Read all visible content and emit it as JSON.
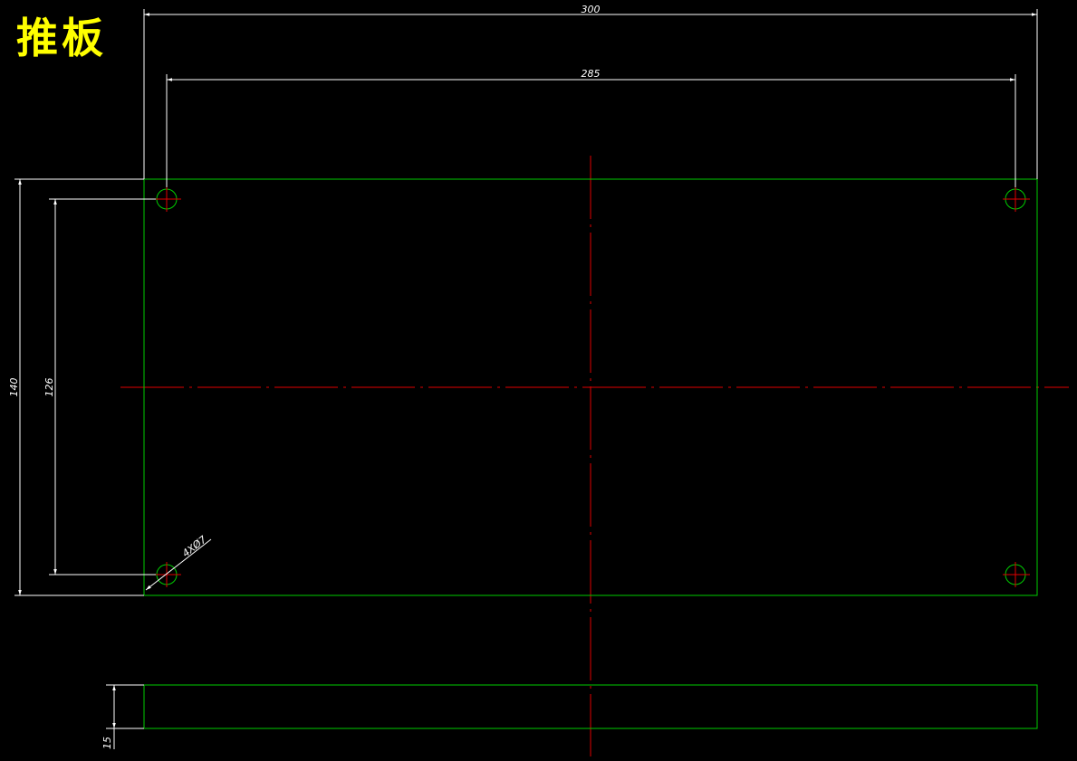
{
  "title": "推板",
  "colors": {
    "background": "#000000",
    "outline": "#00cc00",
    "centerline": "#e00000",
    "dimension": "#ffffff",
    "title": "#ffff00"
  },
  "dimensions": {
    "overall_width": "300",
    "hole_spacing_x": "285",
    "overall_height": "140",
    "hole_spacing_y": "126",
    "hole_callout": "4XØ7",
    "thickness": "15"
  }
}
